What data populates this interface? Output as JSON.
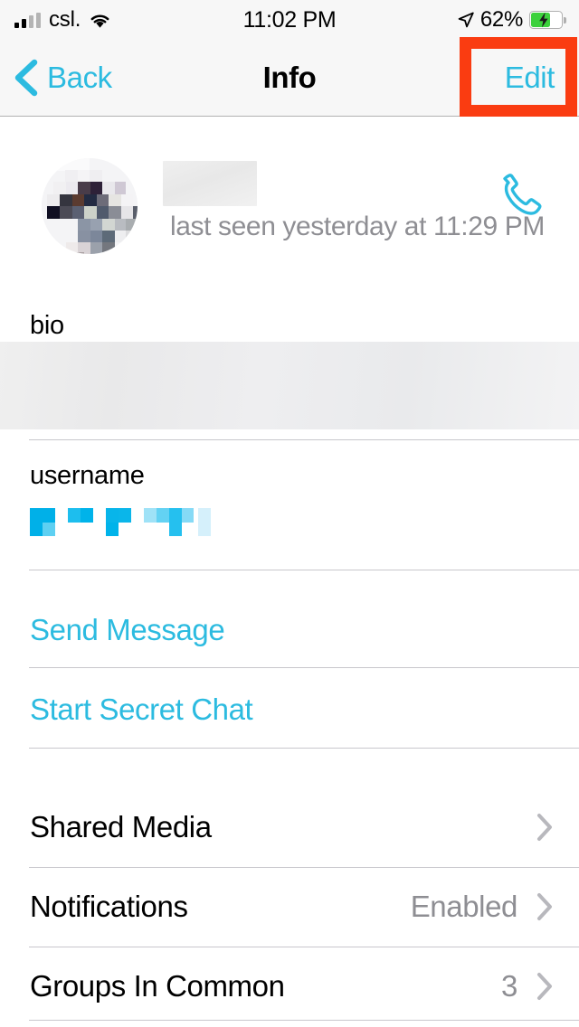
{
  "status_bar": {
    "carrier": "csl.",
    "signal_icon": "signal-bars-icon",
    "wifi_icon": "wifi-icon",
    "time": "11:02 PM",
    "location_icon": "location-arrow-icon",
    "battery_percent": "62%",
    "battery_level": 62,
    "battery_icon": "battery-charging-icon"
  },
  "nav_bar": {
    "back_label": "Back",
    "back_icon": "chevron-left-icon",
    "title": "Info",
    "edit_label": "Edit"
  },
  "annotation": {
    "highlight_color": "#fa3c11",
    "target": "Edit"
  },
  "contact": {
    "avatar_icon": "avatar-image",
    "name_redacted": true,
    "last_seen": "last seen yesterday at 11:29 PM",
    "call_icon": "phone-call-icon"
  },
  "sections": {
    "bio": {
      "label": "bio",
      "value_redacted": true
    },
    "username": {
      "label": "username",
      "value_redacted": true
    }
  },
  "actions": [
    {
      "label": "Send Message",
      "name": "send-message-button"
    },
    {
      "label": "Start Secret Chat",
      "name": "start-secret-chat-button"
    }
  ],
  "nav_rows": [
    {
      "label": "Shared Media",
      "value": "",
      "name": "shared-media-row",
      "chevron_icon": "chevron-right-icon"
    },
    {
      "label": "Notifications",
      "value": "Enabled",
      "name": "notifications-row",
      "chevron_icon": "chevron-right-icon"
    },
    {
      "label": "Groups In Common",
      "value": "3",
      "name": "groups-in-common-row",
      "chevron_icon": "chevron-right-icon"
    }
  ],
  "colors": {
    "accent": "#2cbbe0",
    "text": "#000000",
    "muted": "#8e8e93",
    "separator": "#c8c7cc",
    "bar_bg": "#f7f7f7",
    "highlight": "#fa3c11",
    "battery_green": "#3cd13c"
  }
}
